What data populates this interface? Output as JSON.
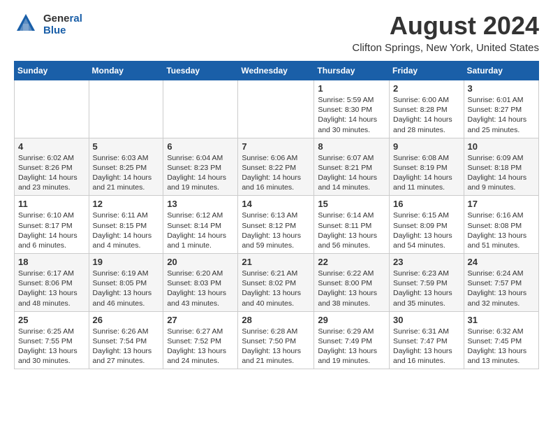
{
  "header": {
    "logo_general": "General",
    "logo_blue": "Blue",
    "month_year": "August 2024",
    "location": "Clifton Springs, New York, United States"
  },
  "calendar": {
    "days_of_week": [
      "Sunday",
      "Monday",
      "Tuesday",
      "Wednesday",
      "Thursday",
      "Friday",
      "Saturday"
    ],
    "weeks": [
      [
        {
          "day": "",
          "info": ""
        },
        {
          "day": "",
          "info": ""
        },
        {
          "day": "",
          "info": ""
        },
        {
          "day": "",
          "info": ""
        },
        {
          "day": "1",
          "info": "Sunrise: 5:59 AM\nSunset: 8:30 PM\nDaylight: 14 hours\nand 30 minutes."
        },
        {
          "day": "2",
          "info": "Sunrise: 6:00 AM\nSunset: 8:28 PM\nDaylight: 14 hours\nand 28 minutes."
        },
        {
          "day": "3",
          "info": "Sunrise: 6:01 AM\nSunset: 8:27 PM\nDaylight: 14 hours\nand 25 minutes."
        }
      ],
      [
        {
          "day": "4",
          "info": "Sunrise: 6:02 AM\nSunset: 8:26 PM\nDaylight: 14 hours\nand 23 minutes."
        },
        {
          "day": "5",
          "info": "Sunrise: 6:03 AM\nSunset: 8:25 PM\nDaylight: 14 hours\nand 21 minutes."
        },
        {
          "day": "6",
          "info": "Sunrise: 6:04 AM\nSunset: 8:23 PM\nDaylight: 14 hours\nand 19 minutes."
        },
        {
          "day": "7",
          "info": "Sunrise: 6:06 AM\nSunset: 8:22 PM\nDaylight: 14 hours\nand 16 minutes."
        },
        {
          "day": "8",
          "info": "Sunrise: 6:07 AM\nSunset: 8:21 PM\nDaylight: 14 hours\nand 14 minutes."
        },
        {
          "day": "9",
          "info": "Sunrise: 6:08 AM\nSunset: 8:19 PM\nDaylight: 14 hours\nand 11 minutes."
        },
        {
          "day": "10",
          "info": "Sunrise: 6:09 AM\nSunset: 8:18 PM\nDaylight: 14 hours\nand 9 minutes."
        }
      ],
      [
        {
          "day": "11",
          "info": "Sunrise: 6:10 AM\nSunset: 8:17 PM\nDaylight: 14 hours\nand 6 minutes."
        },
        {
          "day": "12",
          "info": "Sunrise: 6:11 AM\nSunset: 8:15 PM\nDaylight: 14 hours\nand 4 minutes."
        },
        {
          "day": "13",
          "info": "Sunrise: 6:12 AM\nSunset: 8:14 PM\nDaylight: 14 hours\nand 1 minute."
        },
        {
          "day": "14",
          "info": "Sunrise: 6:13 AM\nSunset: 8:12 PM\nDaylight: 13 hours\nand 59 minutes."
        },
        {
          "day": "15",
          "info": "Sunrise: 6:14 AM\nSunset: 8:11 PM\nDaylight: 13 hours\nand 56 minutes."
        },
        {
          "day": "16",
          "info": "Sunrise: 6:15 AM\nSunset: 8:09 PM\nDaylight: 13 hours\nand 54 minutes."
        },
        {
          "day": "17",
          "info": "Sunrise: 6:16 AM\nSunset: 8:08 PM\nDaylight: 13 hours\nand 51 minutes."
        }
      ],
      [
        {
          "day": "18",
          "info": "Sunrise: 6:17 AM\nSunset: 8:06 PM\nDaylight: 13 hours\nand 48 minutes."
        },
        {
          "day": "19",
          "info": "Sunrise: 6:19 AM\nSunset: 8:05 PM\nDaylight: 13 hours\nand 46 minutes."
        },
        {
          "day": "20",
          "info": "Sunrise: 6:20 AM\nSunset: 8:03 PM\nDaylight: 13 hours\nand 43 minutes."
        },
        {
          "day": "21",
          "info": "Sunrise: 6:21 AM\nSunset: 8:02 PM\nDaylight: 13 hours\nand 40 minutes."
        },
        {
          "day": "22",
          "info": "Sunrise: 6:22 AM\nSunset: 8:00 PM\nDaylight: 13 hours\nand 38 minutes."
        },
        {
          "day": "23",
          "info": "Sunrise: 6:23 AM\nSunset: 7:59 PM\nDaylight: 13 hours\nand 35 minutes."
        },
        {
          "day": "24",
          "info": "Sunrise: 6:24 AM\nSunset: 7:57 PM\nDaylight: 13 hours\nand 32 minutes."
        }
      ],
      [
        {
          "day": "25",
          "info": "Sunrise: 6:25 AM\nSunset: 7:55 PM\nDaylight: 13 hours\nand 30 minutes."
        },
        {
          "day": "26",
          "info": "Sunrise: 6:26 AM\nSunset: 7:54 PM\nDaylight: 13 hours\nand 27 minutes."
        },
        {
          "day": "27",
          "info": "Sunrise: 6:27 AM\nSunset: 7:52 PM\nDaylight: 13 hours\nand 24 minutes."
        },
        {
          "day": "28",
          "info": "Sunrise: 6:28 AM\nSunset: 7:50 PM\nDaylight: 13 hours\nand 21 minutes."
        },
        {
          "day": "29",
          "info": "Sunrise: 6:29 AM\nSunset: 7:49 PM\nDaylight: 13 hours\nand 19 minutes."
        },
        {
          "day": "30",
          "info": "Sunrise: 6:31 AM\nSunset: 7:47 PM\nDaylight: 13 hours\nand 16 minutes."
        },
        {
          "day": "31",
          "info": "Sunrise: 6:32 AM\nSunset: 7:45 PM\nDaylight: 13 hours\nand 13 minutes."
        }
      ]
    ]
  }
}
